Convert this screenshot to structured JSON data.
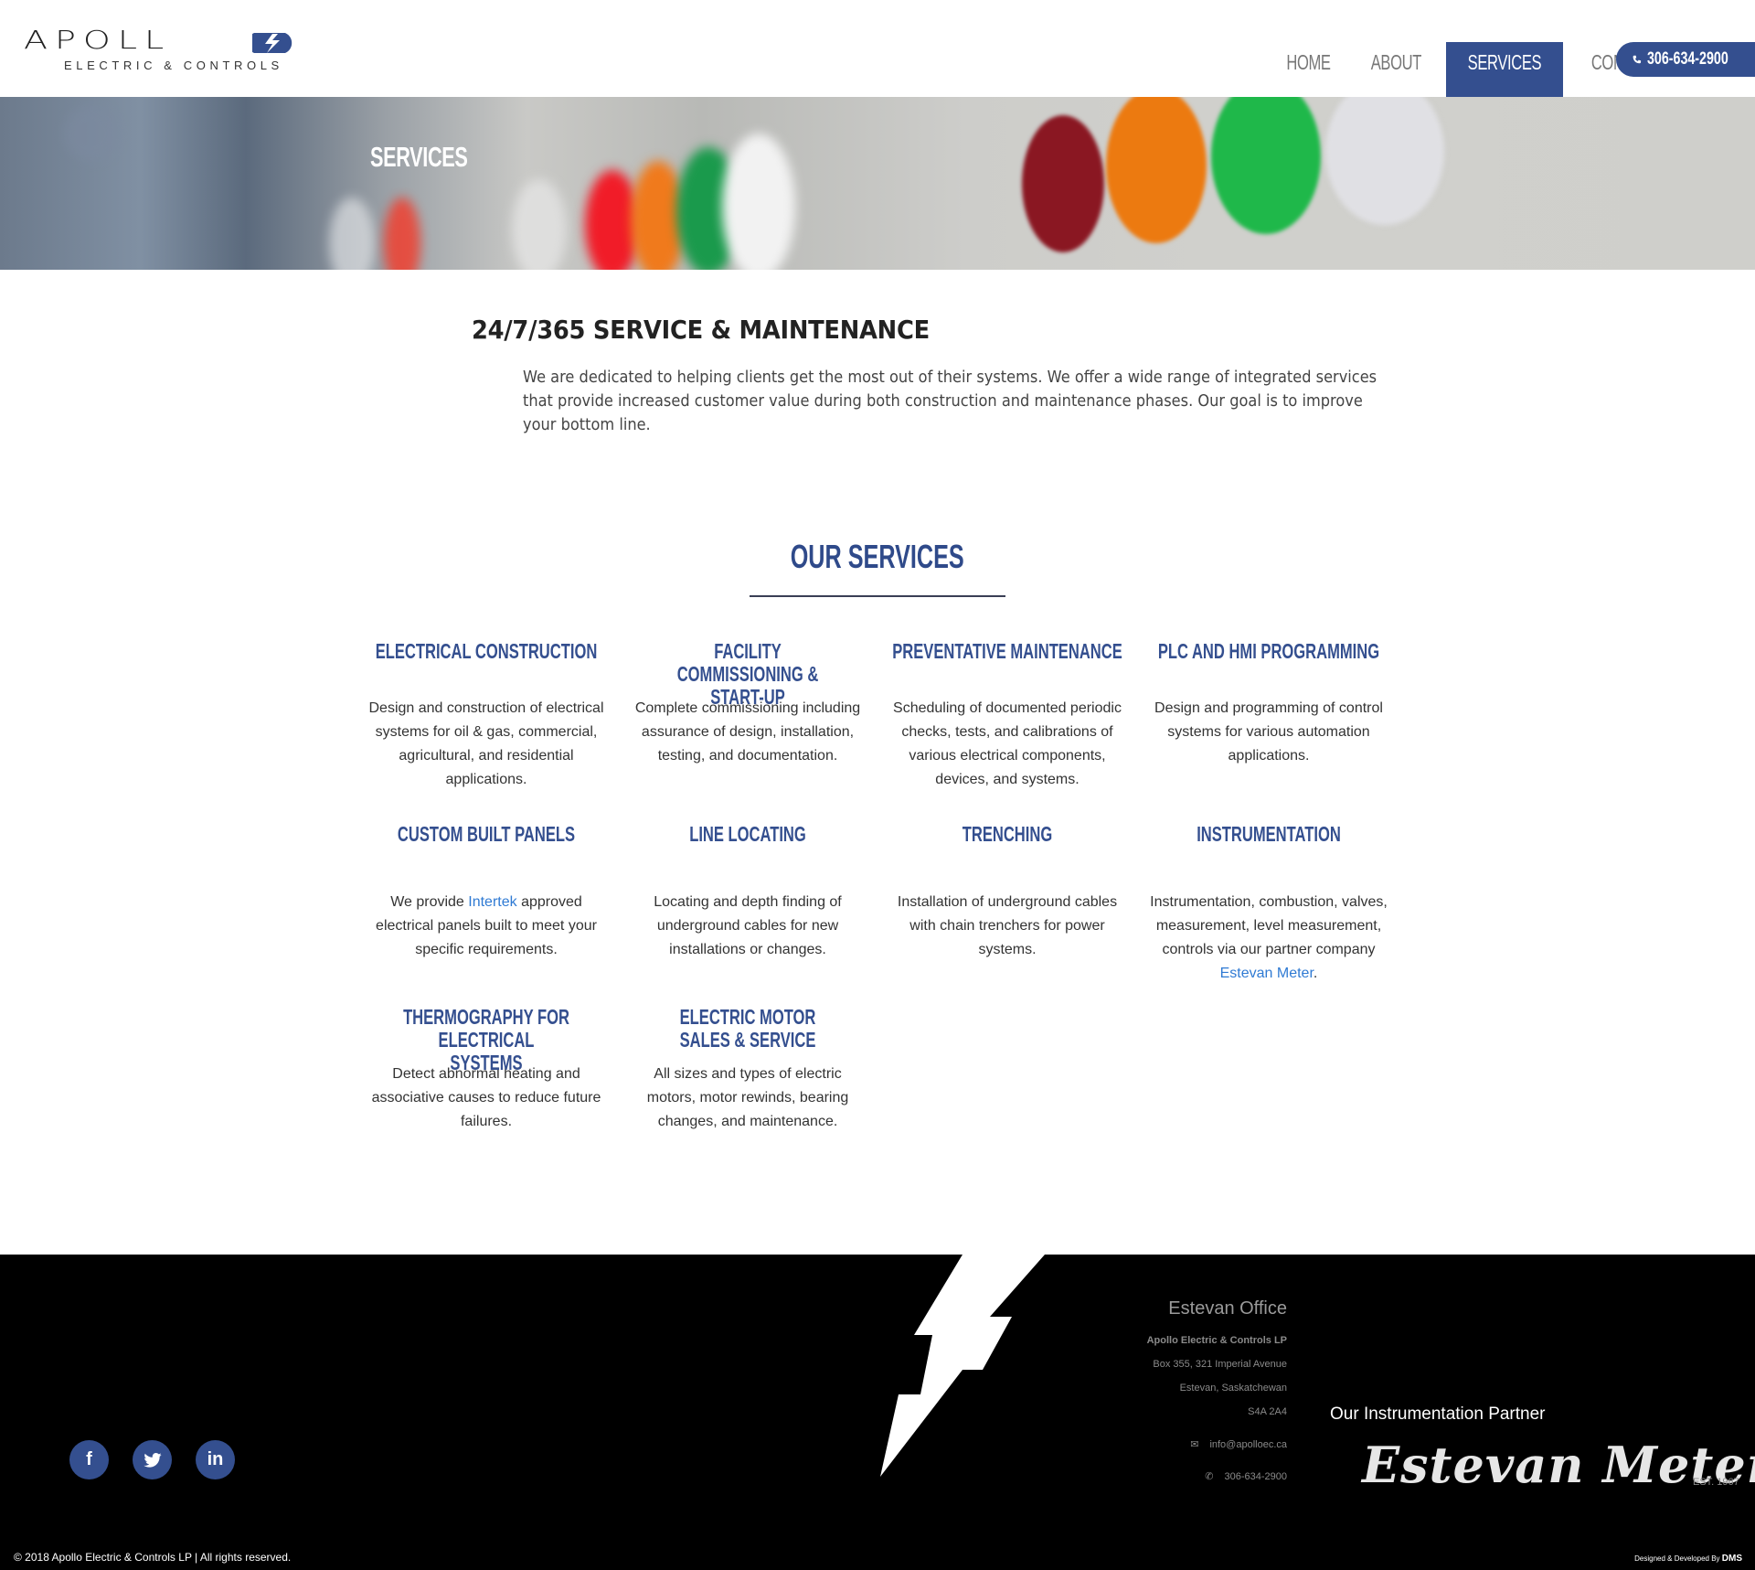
{
  "header": {
    "logo_word": "APOLL",
    "logo_sub": "ELECTRIC & CONTROLS",
    "nav": [
      {
        "label": "HOME",
        "active": false
      },
      {
        "label": "ABOUT",
        "active": false
      },
      {
        "label": "SERVICES",
        "active": true
      },
      {
        "label": "CONTACT",
        "active": false
      }
    ],
    "phone": "306-634-2900",
    "phone_icon": "phone-icon"
  },
  "hero": {
    "title": "SERVICES"
  },
  "intro": {
    "title": "24/7/365 SERVICE & MAINTENANCE",
    "text": "We are dedicated to helping clients get the most out of their systems. We offer a wide range of integrated services that provide increased customer value during both construction and maintenance phases. Our goal is to improve your bottom line."
  },
  "services": {
    "title": "OUR SERVICES",
    "items": [
      {
        "title": "ELECTRICAL CONSTRUCTION",
        "desc": "Design and construction of electrical systems for oil & gas, commercial, agricultural, and residential applications."
      },
      {
        "title": "FACILITY COMMISSIONING & START-UP",
        "desc": "Complete commissioning including assurance of design, installation, testing, and documentation."
      },
      {
        "title": "PREVENTATIVE MAINTENANCE",
        "desc": "Scheduling of documented periodic checks, tests, and calibrations of various electrical components, devices, and systems."
      },
      {
        "title": "PLC AND HMI PROGRAMMING",
        "desc": "Design and programming of control systems for various automation applications."
      },
      {
        "title": "CUSTOM BUILT PANELS",
        "desc_pre": "We provide ",
        "link": "Intertek",
        "desc_post": " approved electrical panels built to meet your specific requirements."
      },
      {
        "title": "LINE LOCATING",
        "desc": "Locating and depth finding of underground cables for new installations or changes."
      },
      {
        "title": "TRENCHING",
        "desc": "Installation of underground cables with chain trenchers for power systems."
      },
      {
        "title": "INSTRUMENTATION",
        "desc_pre": "Instrumentation, combustion, valves, measurement, level measurement, controls via our partner company ",
        "link": "Estevan Meter",
        "desc_post": "."
      },
      {
        "title": "THERMOGRAPHY FOR ELECTRICAL SYSTEMS",
        "desc": "Detect abnormal heating and associative causes to reduce future failures."
      },
      {
        "title": "ELECTRIC MOTOR SALES & SERVICE",
        "desc": "All sizes and types of electric motors, motor rewinds, bearing changes, and maintenance."
      }
    ]
  },
  "footer": {
    "office": {
      "title": "Estevan Office",
      "company": "Apollo Electric & Controls LP",
      "address1": "Box 355, 321 Imperial Avenue",
      "address2": "Estevan, Saskatchewan",
      "postal": "S4A 2A4",
      "email": "info@apolloec.ca",
      "phone": "306-634-2900"
    },
    "partner_label": "Our Instrumentation Partner",
    "partner_name": "Estevan Meter",
    "partner_est": "EST. 1967",
    "social": [
      {
        "name": "facebook",
        "glyph": "f"
      },
      {
        "name": "twitter",
        "glyph": "🐦"
      },
      {
        "name": "linkedin",
        "glyph": "in"
      }
    ],
    "copyright": "© 2018 Apollo Electric & Controls LP | All rights reserved.",
    "credits_pre": "Designed & Developed By ",
    "credits_brand": "DMS"
  },
  "colors": {
    "brand_blue": "#344f8f",
    "heading_blue": "#2f4a8a",
    "link_blue": "#2f7ad3",
    "footer_bg": "#000000"
  }
}
